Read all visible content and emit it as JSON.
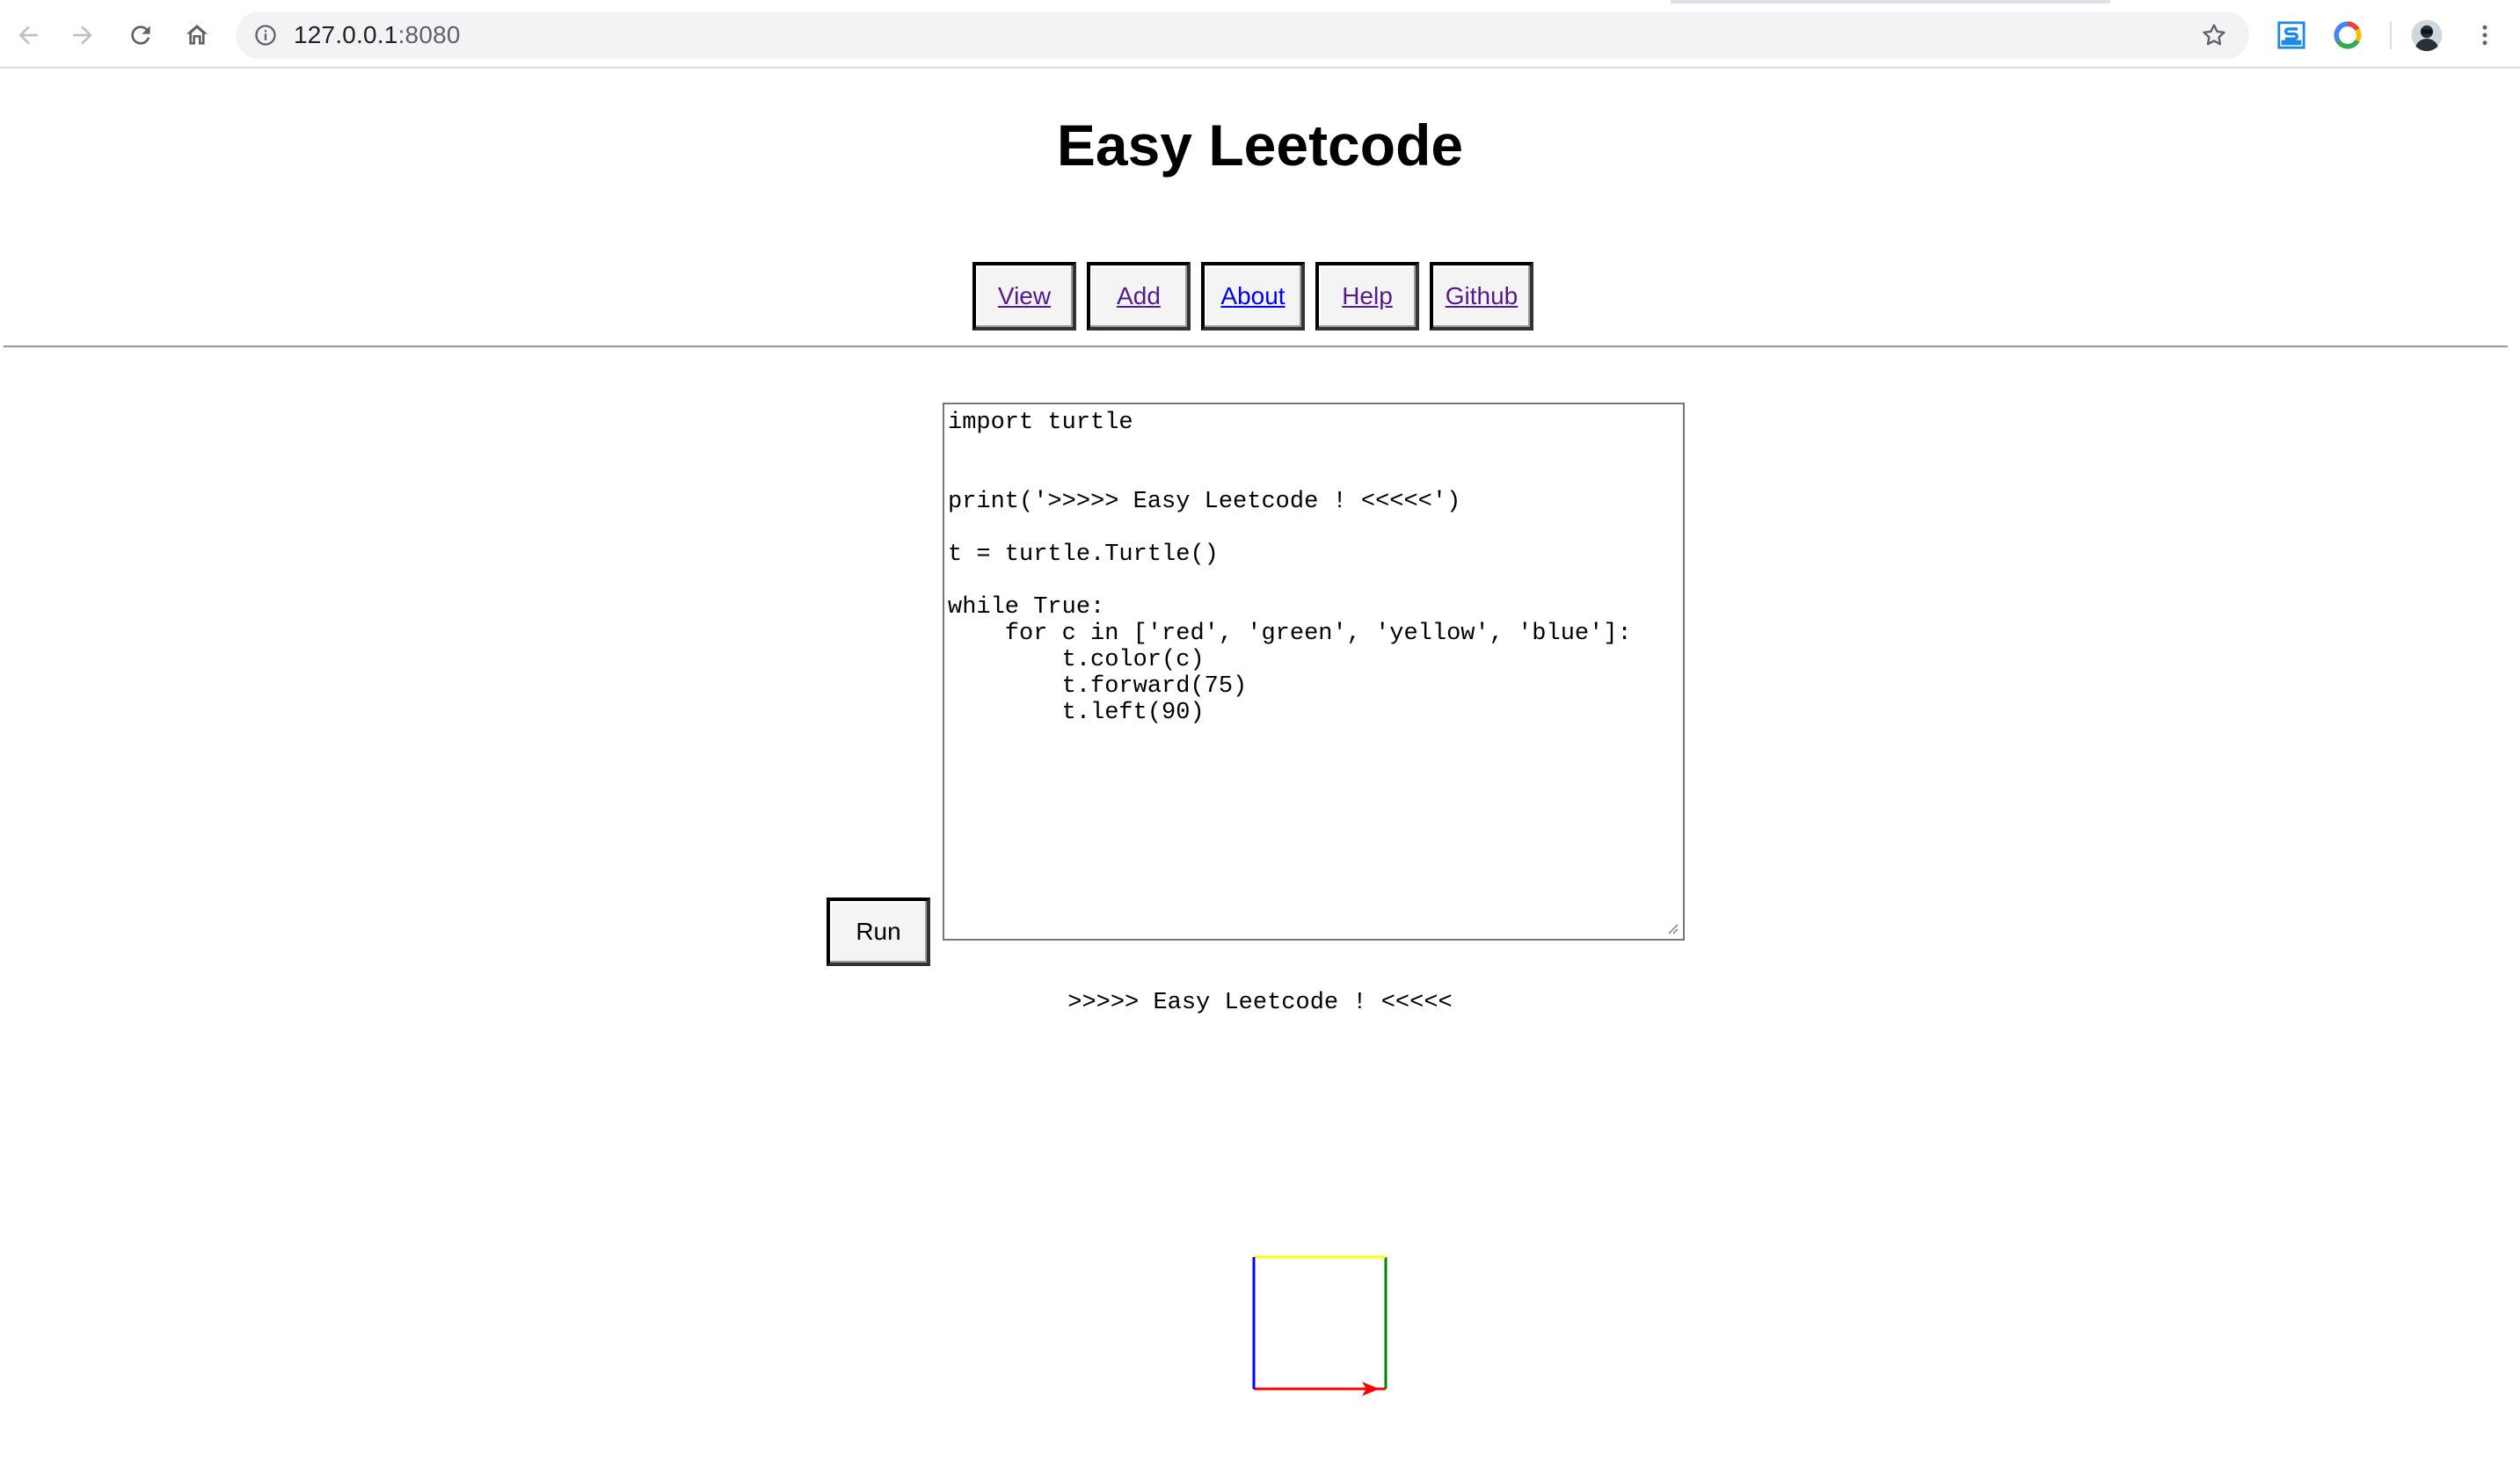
{
  "browser": {
    "url_host": "127.0.0.1",
    "url_port": ":8080"
  },
  "page": {
    "title": "Easy Leetcode",
    "nav": [
      {
        "label": "View"
      },
      {
        "label": "Add"
      },
      {
        "label": "About"
      },
      {
        "label": "Help"
      },
      {
        "label": "Github"
      }
    ],
    "run_label": "Run",
    "code": "import turtle\n\n\nprint('>>>>> Easy Leetcode ! <<<<<')\n\nt = turtle.Turtle()\n\nwhile True:\n    for c in ['red', 'green', 'yellow', 'blue']:\n        t.color(c)\n        t.forward(75)\n        t.left(90)",
    "output": ">>>>> Easy Leetcode ! <<<<<"
  },
  "turtle": {
    "colors": [
      "red",
      "green",
      "yellow",
      "blue"
    ],
    "step": 75,
    "turn_degrees": 90
  }
}
